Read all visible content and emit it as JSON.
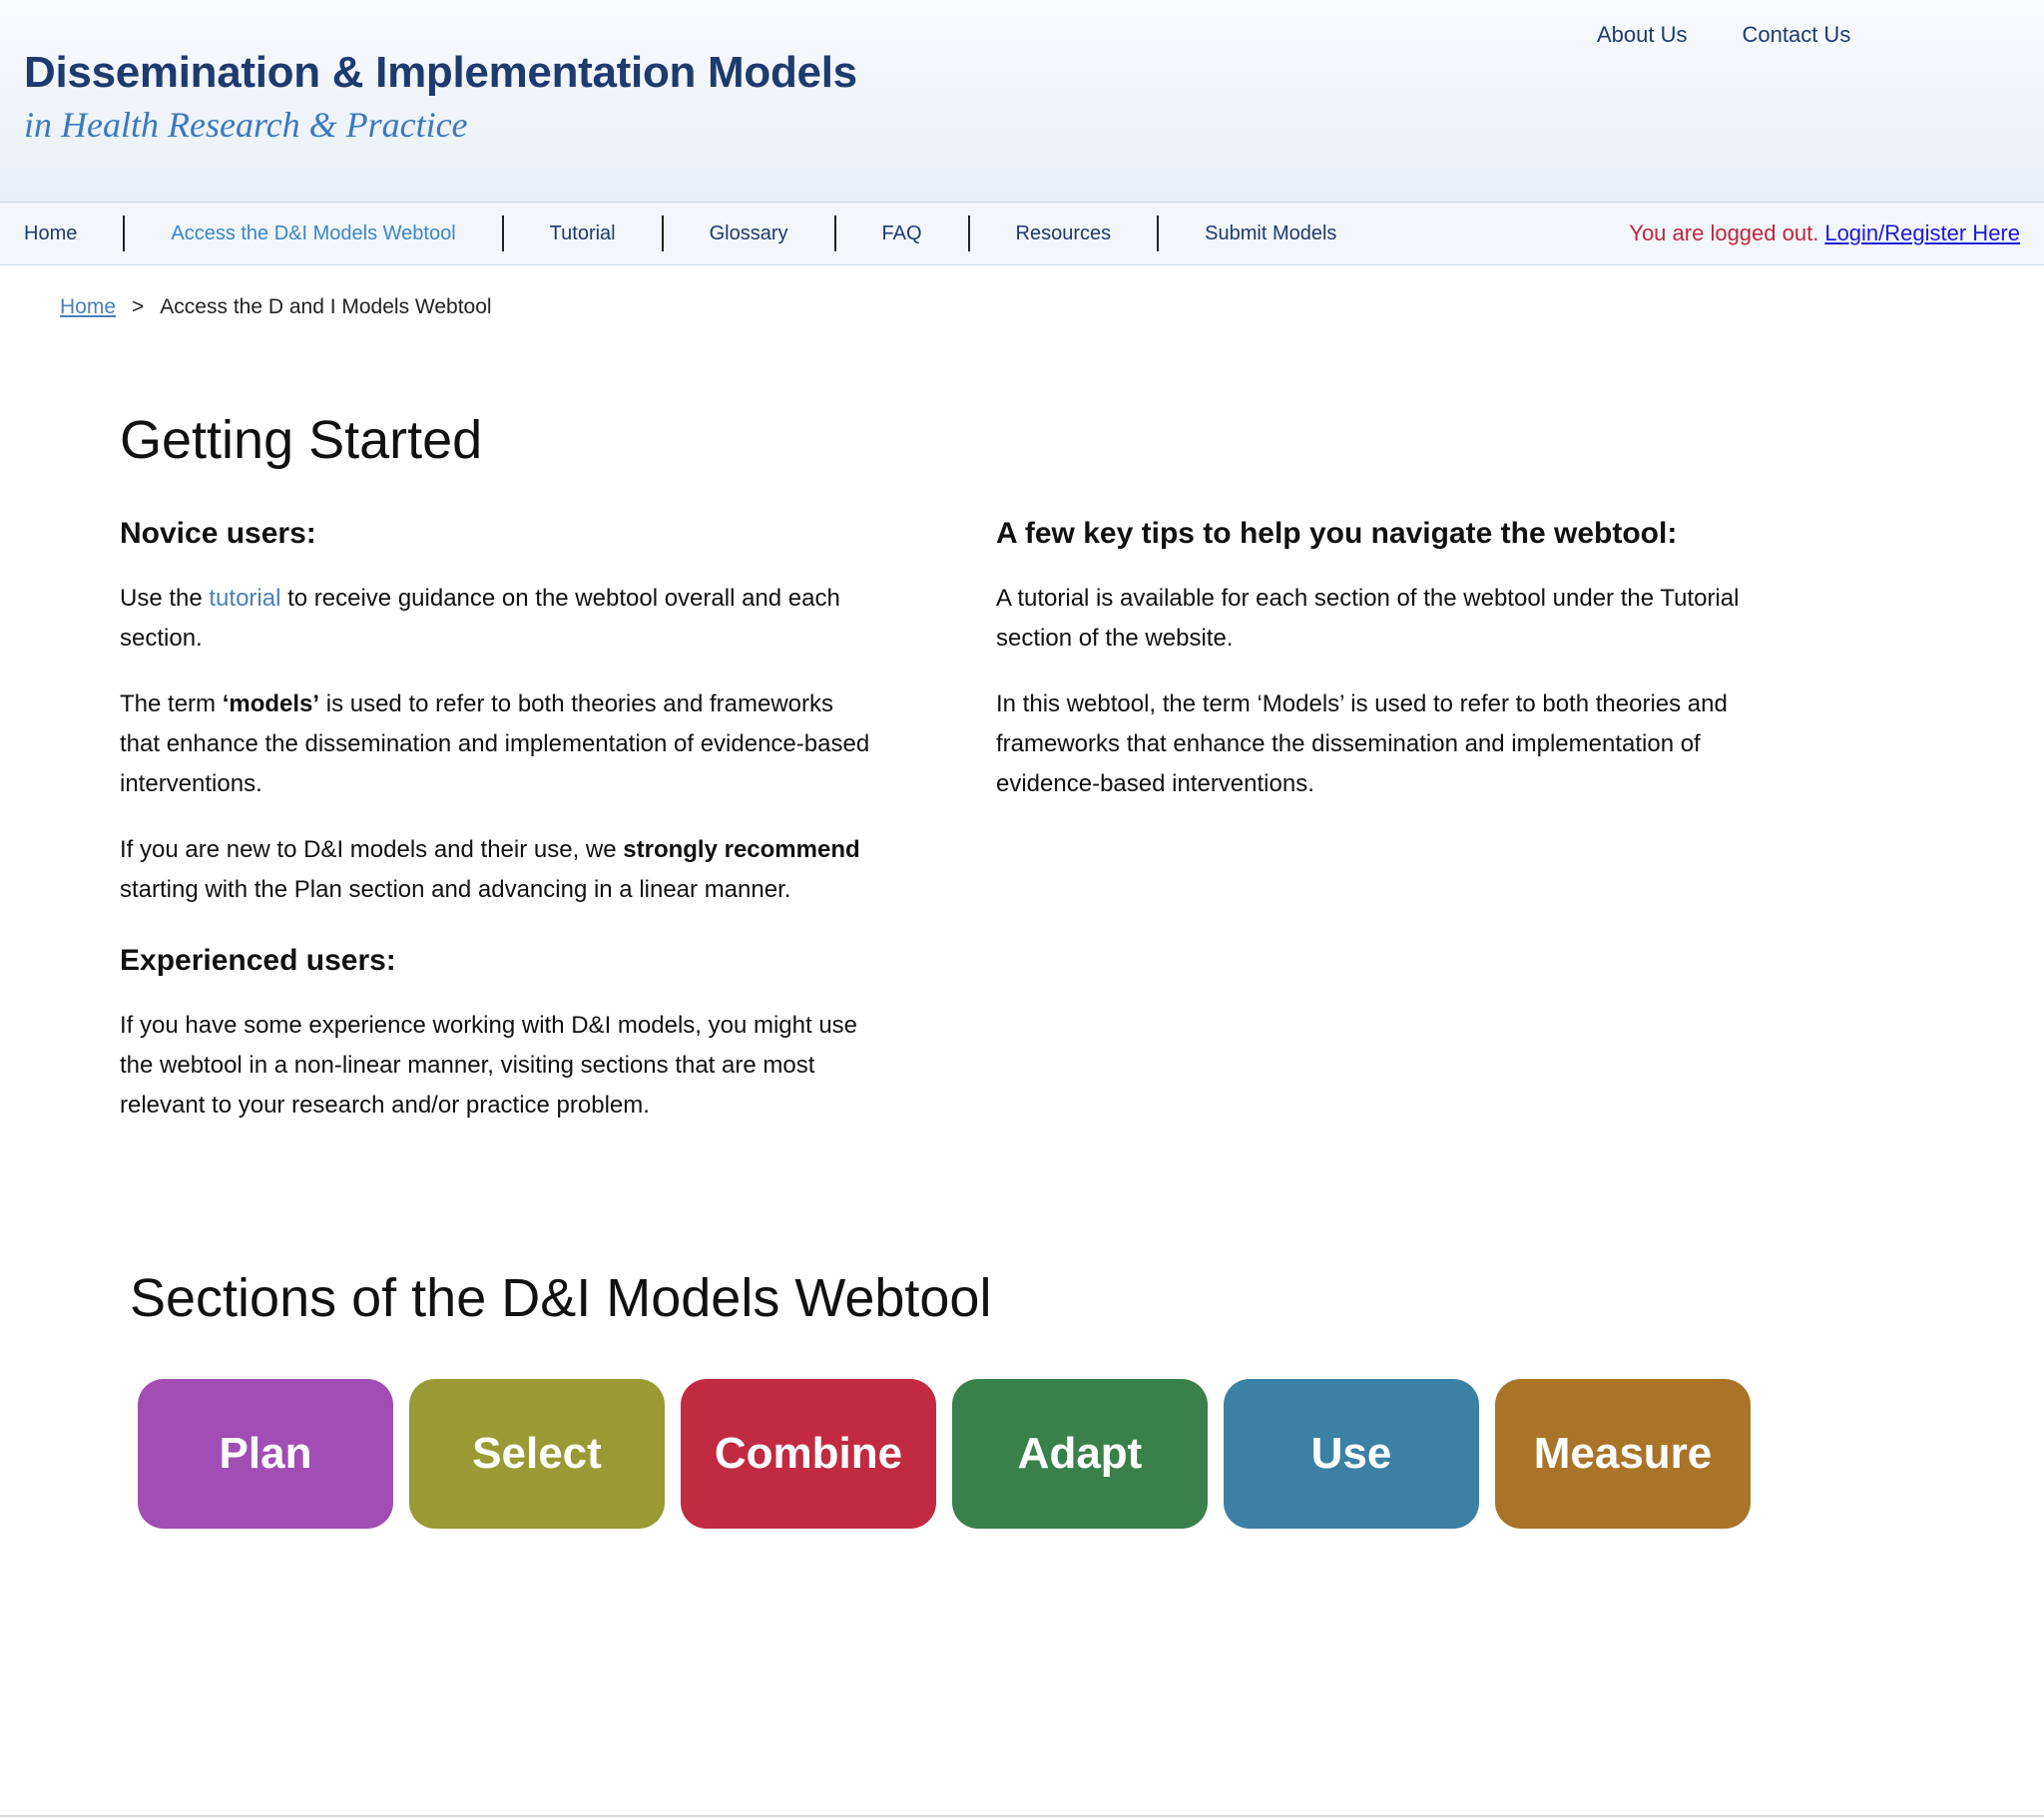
{
  "header": {
    "title": "Dissemination & Implementation Models",
    "subtitle": "in Health Research & Practice",
    "top_links": [
      "About Us",
      "Contact Us"
    ]
  },
  "nav": {
    "items": [
      {
        "label": "Home",
        "active": false
      },
      {
        "label": "Access the D&I Models Webtool",
        "active": true
      },
      {
        "label": "Tutorial",
        "active": false
      },
      {
        "label": "Glossary",
        "active": false
      },
      {
        "label": "FAQ",
        "active": false
      },
      {
        "label": "Resources",
        "active": false
      },
      {
        "label": "Submit Models",
        "active": false
      }
    ],
    "status_text": "You are logged out.",
    "login_link": "Login/Register Here"
  },
  "breadcrumb": {
    "home": "Home",
    "separator": ">",
    "current": "Access the D and I Models Webtool"
  },
  "main": {
    "title": "Getting Started",
    "novice": {
      "heading": "Novice users:",
      "p1_pre": "Use the ",
      "p1_link": "tutorial",
      "p1_post": " to receive guidance on the webtool overall and each section.",
      "p2_pre": "The term ",
      "p2_bold": "‘models’",
      "p2_post": " is used to refer to both theories and frameworks that enhance the dissemination and implementation of evidence-based interventions.",
      "p3_pre": "If you are new to D&I models and their use, we ",
      "p3_bold": "strongly recommend",
      "p3_post": " starting with the Plan section and advancing in a linear manner."
    },
    "experienced": {
      "heading": "Experienced users:",
      "p1": "If you have some experience working with D&I models, you might use the webtool in a non-linear manner, visiting sections that are most relevant to your research and/or practice problem."
    },
    "tips": {
      "heading": "A few key tips to help you navigate the webtool:",
      "p1": "A tutorial is available for each section of the webtool under the Tutorial section of the website.",
      "p2": "In this webtool, the term ‘Models’ is used to refer to both theories and frameworks that enhance the dissemination and implementation of evidence-based interventions."
    }
  },
  "sections": {
    "title": "Sections of the D&I Models Webtool",
    "buttons": [
      {
        "label": "Plan",
        "color": "#a14db3"
      },
      {
        "label": "Select",
        "color": "#999a33"
      },
      {
        "label": "Combine",
        "color": "#c12a40"
      },
      {
        "label": "Adapt",
        "color": "#3a804a"
      },
      {
        "label": "Use",
        "color": "#3c81a5"
      },
      {
        "label": "Measure",
        "color": "#a97428"
      }
    ]
  },
  "colors": {
    "brand_navy": "#1d3b6e",
    "brand_blue": "#3a78c0",
    "logged_out_red": "#c0263d",
    "login_link_blue": "#1a1ad8"
  }
}
